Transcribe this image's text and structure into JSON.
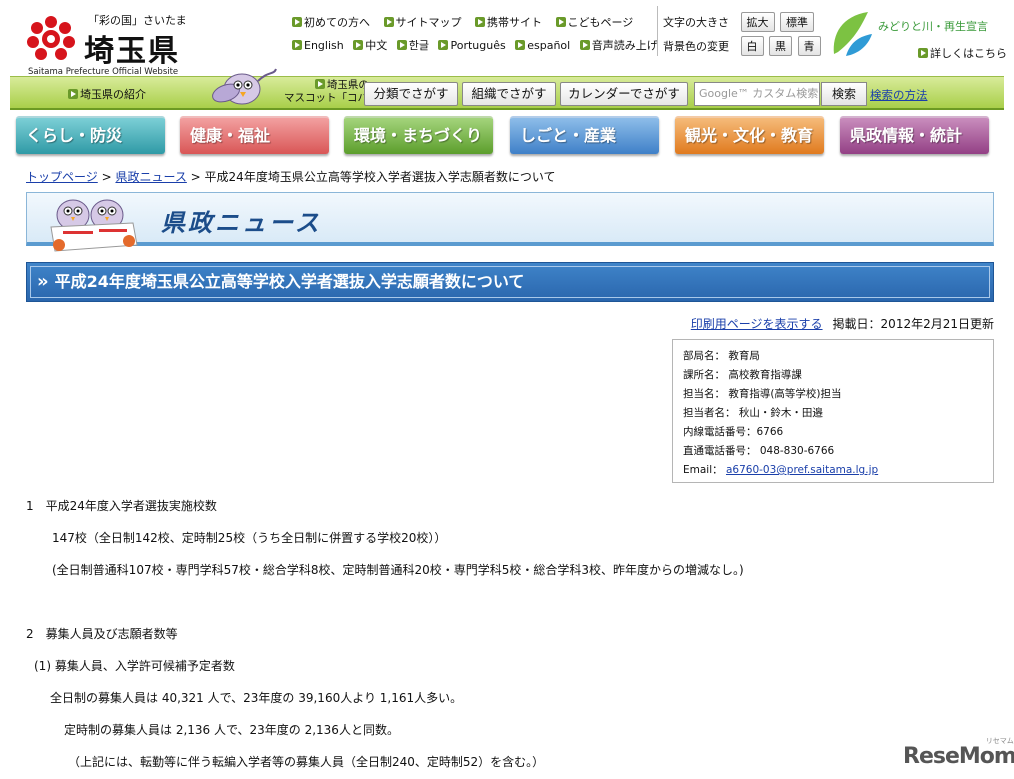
{
  "header": {
    "catch": "「彩の国」さいたま",
    "site_name": "埼玉県",
    "site_name_en": "Saitama Prefecture Official Website",
    "links_row1": [
      "初めての方へ",
      "サイトマップ",
      "携帯サイト",
      "こどもページ"
    ],
    "links_row2": [
      "English",
      "中文",
      "한글",
      "Português",
      "español",
      "音声読み上げ"
    ],
    "font_size_label": "文字の大きさ",
    "font_size_buttons": [
      "拡大",
      "標準"
    ],
    "bg_color_label": "背景色の変更",
    "bg_color_buttons": [
      "白",
      "黒",
      "青"
    ],
    "midori_text": "みどりと川・再生宣言",
    "midori_link": "詳しくはこちら"
  },
  "subbar": {
    "intro": "埼玉県の紹介",
    "mascot_label_1": "埼玉県の",
    "mascot_label_2": "マスコット「コバトン」",
    "buttons": [
      "分類でさがす",
      "組織でさがす",
      "カレンダーでさがす"
    ],
    "search_placeholder": "Google™ カスタム検索",
    "search_button": "検索",
    "search_help": "検索の方法"
  },
  "categories": [
    {
      "label": "くらし・防災",
      "color": "#3aa9b5"
    },
    {
      "label": "健康・福祉",
      "color": "#e46a6a"
    },
    {
      "label": "環境・まちづくり",
      "color": "#6cab3c"
    },
    {
      "label": "しごと・産業",
      "color": "#4a8ed3"
    },
    {
      "label": "観光・文化・教育",
      "color": "#e8892b"
    },
    {
      "label": "県政情報・統計",
      "color": "#a04f92"
    }
  ],
  "breadcrumb": {
    "top": "トップページ",
    "sep1": " > ",
    "news": "県政ニュース",
    "sep2": " > ",
    "current": "平成24年度埼玉県公立高等学校入学者選抜入学志願者数について"
  },
  "banner_title": "県政ニュース",
  "page_title": "平成24年度埼玉県公立高等学校入学者選抜入学志願者数について",
  "print_link": "印刷用ページを表示する",
  "posted_date": "掲載日：2012年2月21日更新",
  "contact": {
    "dept": "部局名：  教育局",
    "section": "課所名：  高校教育指導課",
    "charge": "担当名：  教育指導(高等学校)担当",
    "person": "担当者名：  秋山・鈴木・田邉",
    "ext": "内線電話番号：6766",
    "direct": "直通電話番号：  048-830-6766",
    "email_label": "Email：  ",
    "email": "a6760-03@pref.saitama.lg.jp"
  },
  "body": {
    "s1_heading": "1　平成24年度入学者選抜実施校数",
    "s1_line1": "147校（全日制142校、定時制25校（うち全日制に併置する学校20校））",
    "s1_line2": "(全日制普通科107校・専門学科57校・総合学科8校、定時制普通科20校・専門学科5校・総合学科3校、昨年度からの増減なし。)",
    "s2_heading": "2　募集人員及び志願者数等",
    "s2_sub": "(1) 募集人員、入学許可候補予定者数",
    "s2_line1": "全日制の募集人員は 40,321 人で、23年度の  39,160人より 1,161人多い。",
    "s2_line2": "定時制の募集人員は  2,136 人で、23年度の   2,136人と同数。",
    "s2_line3": "（上記には、転勤等に伴う転編入学者等の募集人員（全日制240、定時制52）を含む。）"
  },
  "watermark": "ReseMom",
  "watermark_small": "リセマム"
}
